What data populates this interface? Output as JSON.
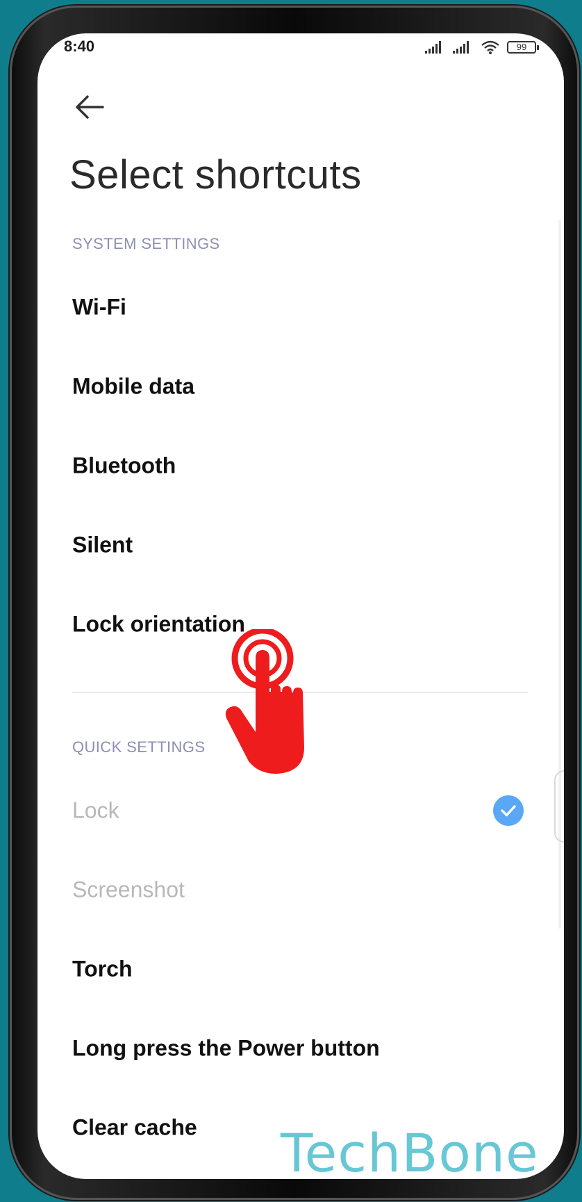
{
  "status_bar": {
    "time": "8:40",
    "battery": "99",
    "icons": [
      "signal-icon",
      "signal-icon",
      "wifi-icon",
      "battery-icon"
    ]
  },
  "header": {
    "back_icon": "arrow-left-icon",
    "title": "Select shortcuts"
  },
  "system_settings": {
    "label": "SYSTEM SETTINGS",
    "items": [
      {
        "label": "Wi-Fi"
      },
      {
        "label": "Mobile data"
      },
      {
        "label": "Bluetooth"
      },
      {
        "label": "Silent"
      },
      {
        "label": "Lock orientation"
      }
    ]
  },
  "quick_settings": {
    "label": "QUICK SETTINGS",
    "items": [
      {
        "label": "Lock",
        "state": "disabled",
        "checked": true
      },
      {
        "label": "Screenshot",
        "state": "disabled",
        "checked": false
      },
      {
        "label": "Torch",
        "state": "enabled",
        "checked": false
      },
      {
        "label": "Long press the Power button",
        "state": "enabled",
        "checked": false
      },
      {
        "label": "Clear cache",
        "state": "enabled",
        "checked": false
      }
    ]
  },
  "overlay": {
    "tap_icon": "hand-tap-icon",
    "watermark": "TechBone"
  },
  "colors": {
    "background": "#0f7d8c",
    "accent": "#5aa7f5",
    "section_header": "#8c8fb5",
    "tap_icon": "#ee1c1c",
    "watermark": "#67c7d4"
  }
}
